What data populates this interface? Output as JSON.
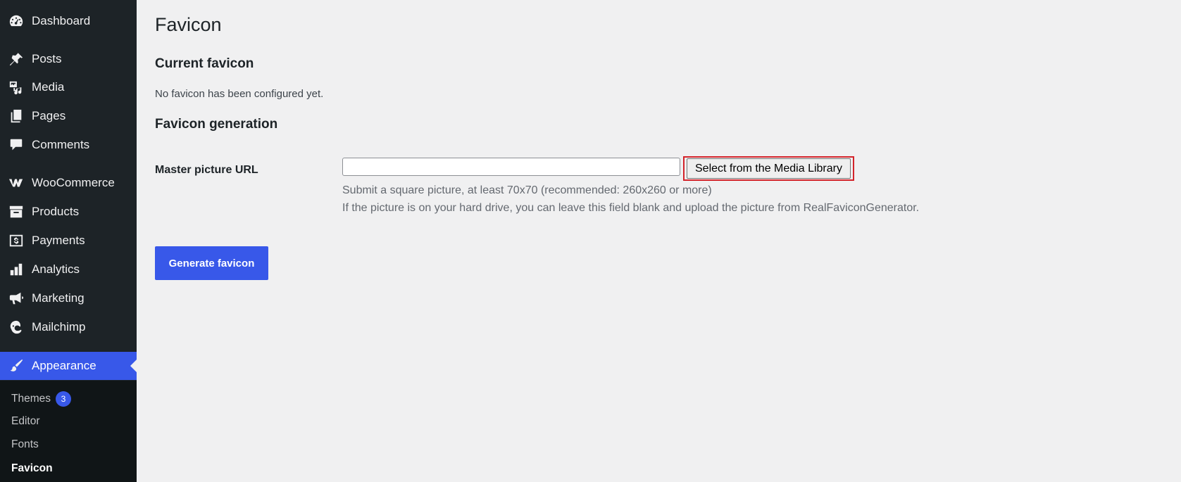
{
  "sidebar": {
    "items": [
      {
        "label": "Dashboard",
        "icon": "dashboard-icon"
      },
      {
        "label": "Posts",
        "icon": "pushpin-icon"
      },
      {
        "label": "Media",
        "icon": "media-icon"
      },
      {
        "label": "Pages",
        "icon": "pages-icon"
      },
      {
        "label": "Comments",
        "icon": "comment-icon"
      },
      {
        "label": "WooCommerce",
        "icon": "woocommerce-icon"
      },
      {
        "label": "Products",
        "icon": "archive-box-icon"
      },
      {
        "label": "Payments",
        "icon": "dollar-icon"
      },
      {
        "label": "Analytics",
        "icon": "bar-chart-icon"
      },
      {
        "label": "Marketing",
        "icon": "megaphone-icon"
      },
      {
        "label": "Mailchimp",
        "icon": "mailchimp-icon"
      },
      {
        "label": "Appearance",
        "icon": "paintbrush-icon"
      }
    ],
    "submenu": [
      {
        "label": "Themes",
        "badge": "3"
      },
      {
        "label": "Editor"
      },
      {
        "label": "Fonts"
      },
      {
        "label": "Favicon"
      }
    ]
  },
  "main": {
    "title": "Favicon",
    "current_section_title": "Current favicon",
    "current_status": "No favicon has been configured yet.",
    "generation_section_title": "Favicon generation",
    "field_label": "Master picture URL",
    "url_value": "",
    "media_button_label": "Select from the Media Library",
    "hint_line_1": "Submit a square picture, at least 70x70 (recommended: 260x260 or more)",
    "hint_line_2": "If the picture is on your hard drive, you can leave this field blank and upload the picture from RealFaviconGenerator.",
    "generate_button_label": "Generate favicon"
  },
  "colors": {
    "sidebar_bg": "#1d2327",
    "submenu_bg": "#101517",
    "accent": "#3858e9",
    "page_bg": "#f0f0f1",
    "highlight": "#d3232a"
  }
}
